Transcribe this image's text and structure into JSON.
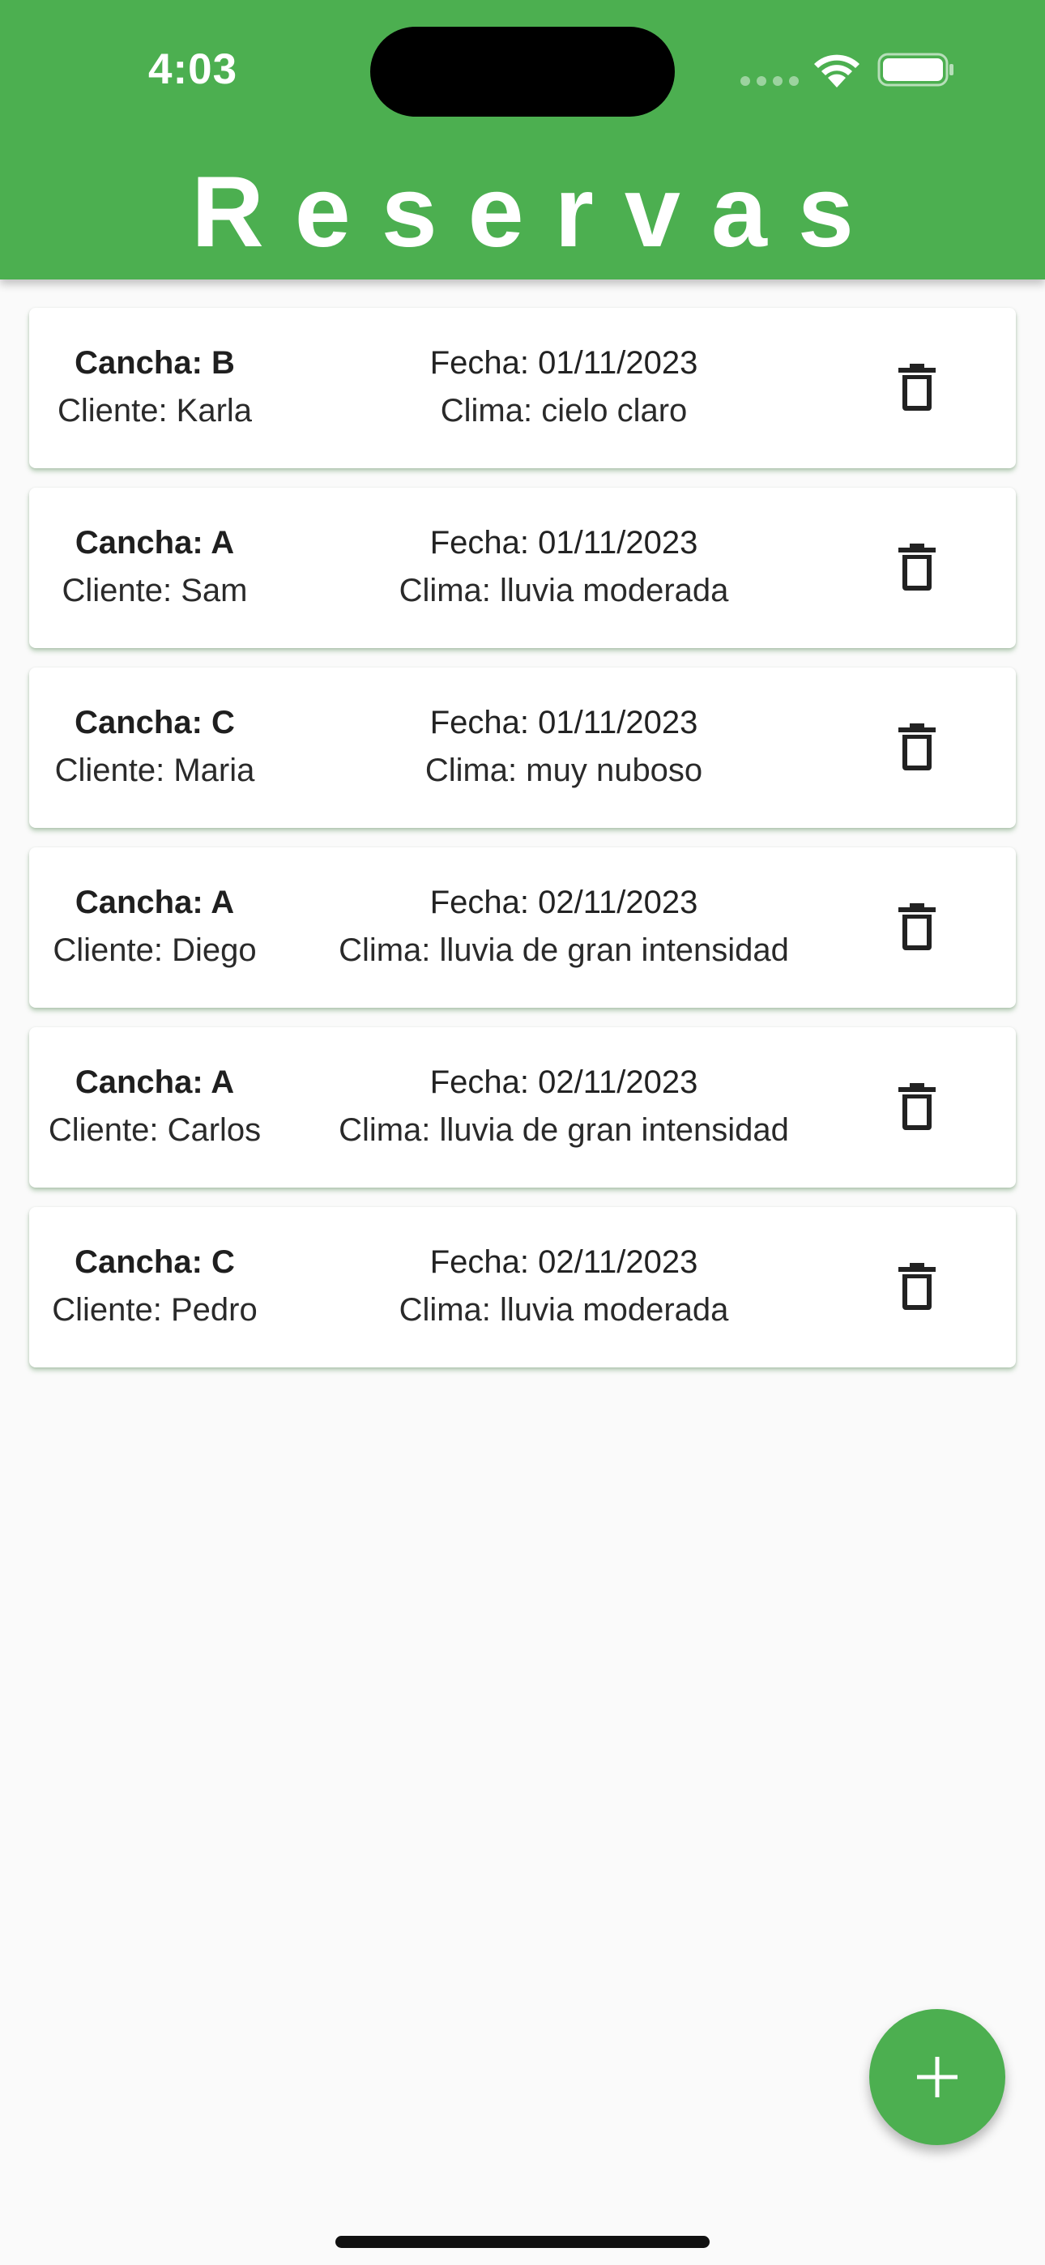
{
  "status_bar": {
    "time": "4:03"
  },
  "header": {
    "title": "Reservas",
    "background_color": "#4caf50"
  },
  "reservations": [
    {
      "cancha": "Cancha: B",
      "cliente": "Cliente: Karla",
      "fecha": "Fecha: 01/11/2023",
      "clima": "Clima: cielo claro"
    },
    {
      "cancha": "Cancha: A",
      "cliente": "Cliente: Sam",
      "fecha": "Fecha: 01/11/2023",
      "clima": "Clima: lluvia moderada"
    },
    {
      "cancha": "Cancha: C",
      "cliente": "Cliente: Maria",
      "fecha": "Fecha: 01/11/2023",
      "clima": "Clima: muy nuboso"
    },
    {
      "cancha": "Cancha: A",
      "cliente": "Cliente: Diego",
      "fecha": "Fecha: 02/11/2023",
      "clima": "Clima: lluvia de gran intensidad"
    },
    {
      "cancha": "Cancha: A",
      "cliente": "Cliente: Carlos",
      "fecha": "Fecha: 02/11/2023",
      "clima": "Clima: lluvia de gran intensidad"
    },
    {
      "cancha": "Cancha: C",
      "cliente": "Cliente: Pedro",
      "fecha": "Fecha: 02/11/2023",
      "clima": "Clima: lluvia moderada"
    }
  ],
  "icons": {
    "delete": "trash-icon",
    "add": "plus-icon"
  },
  "fab": {
    "background_color": "#4caf50"
  }
}
